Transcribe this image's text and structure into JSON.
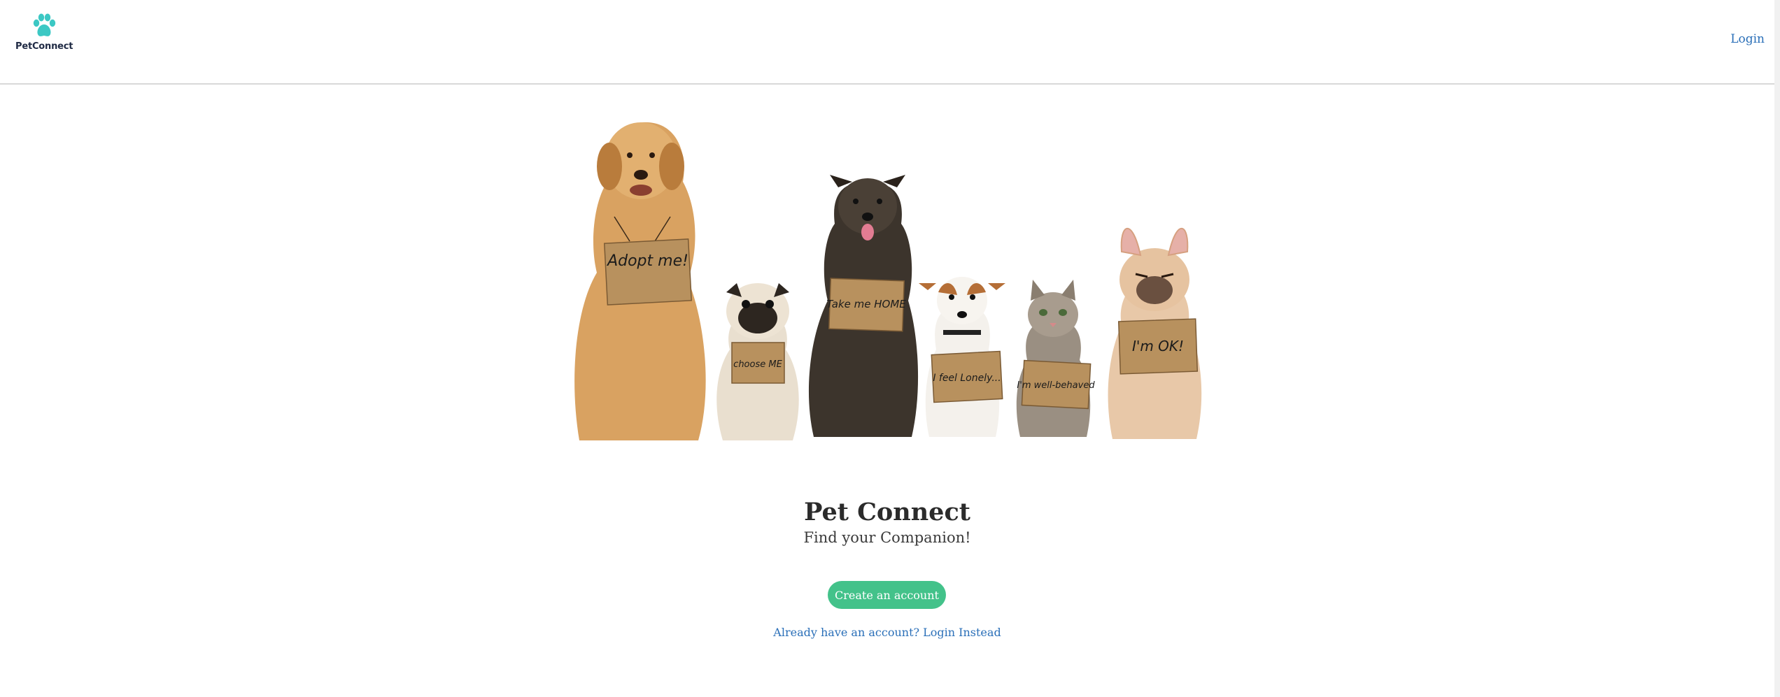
{
  "header": {
    "brand_name": "PetConnect",
    "login_label": "Login"
  },
  "hero": {
    "signs": [
      "Adopt me!",
      "choose ME",
      "Take me HOME",
      "I feel Lonely...",
      "I'm well-behaved",
      "I'm OK!"
    ]
  },
  "main": {
    "title": "Pet Connect",
    "subtitle": "Find your Companion!",
    "create_account_label": "Create an account",
    "login_instead_label": "Already have an account? Login Instead"
  },
  "colors": {
    "brand_teal": "#3cc8c4",
    "cta_green": "#43c28a",
    "link_blue": "#2a6fb8"
  }
}
